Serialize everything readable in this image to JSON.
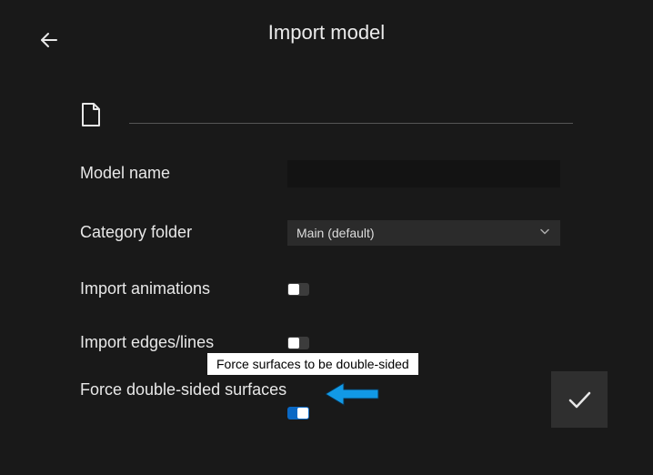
{
  "header": {
    "title": "Import model"
  },
  "fields": {
    "model_name": {
      "label": "Model name",
      "value": ""
    },
    "category_folder": {
      "label": "Category folder",
      "selected": "Main (default)"
    },
    "import_animations": {
      "label": "Import animations",
      "on": false
    },
    "import_edges": {
      "label": "Import edges/lines",
      "on": false
    },
    "force_double_sided": {
      "label": "Force double-sided surfaces",
      "on": true
    }
  },
  "tooltip": "Force surfaces to be double-sided",
  "colors": {
    "accent": "#0a68c4",
    "annotation_arrow": "#1199e6"
  }
}
